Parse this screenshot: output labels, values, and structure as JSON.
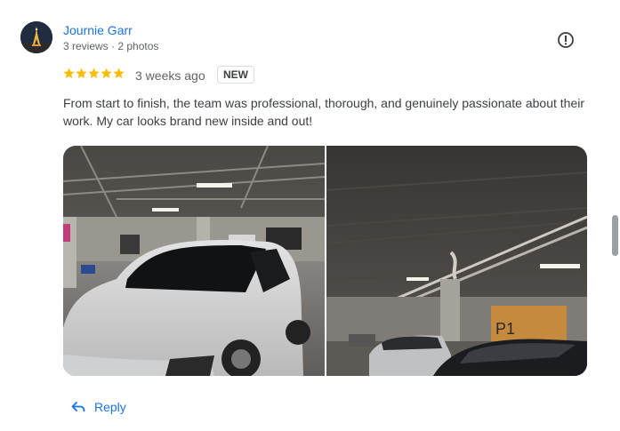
{
  "review": {
    "author": "Journie Garr",
    "author_meta": "3 reviews · 2 photos",
    "rating": 5,
    "time_ago": "3 weeks ago",
    "badge": "NEW",
    "text": "From start to finish, the team was professional, thorough, and genuinely passionate about their work. My car looks brand new inside and out!"
  },
  "photos": [
    {
      "subject": "white sedan in parking garage"
    },
    {
      "subject": "parking garage ceiling with cars, level P1"
    }
  ],
  "garage_sign": "P1",
  "actions": {
    "reply_label": "Reply"
  },
  "icons": {
    "report": "report-icon",
    "reply": "reply-arrow-icon",
    "star": "star-icon"
  },
  "colors": {
    "link": "#1a73e8",
    "star": "#fbbc04",
    "meta": "#5f6368"
  }
}
